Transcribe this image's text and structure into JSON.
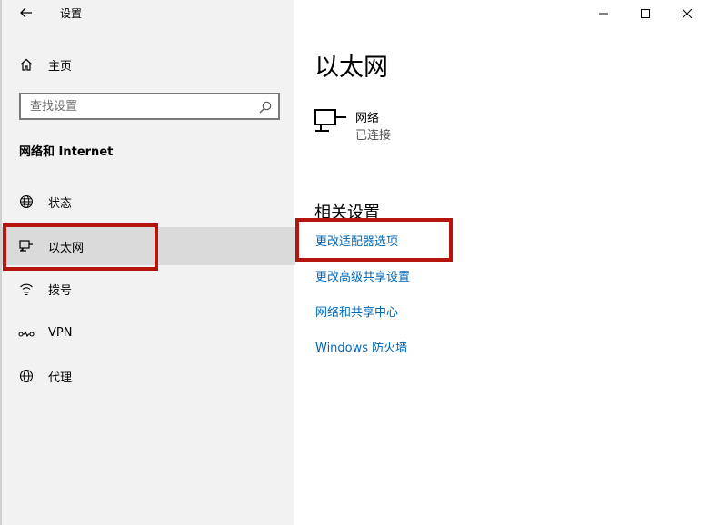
{
  "window": {
    "title": "设置",
    "controls": {
      "minimize": "—",
      "maximize": "☐",
      "close": "✕"
    }
  },
  "sidebar": {
    "home_label": "主页",
    "search": {
      "placeholder": "查找设置",
      "value": ""
    },
    "section_title": "网络和 Internet",
    "items": [
      {
        "label": "状态",
        "icon": "status-globe-icon",
        "selected": false
      },
      {
        "label": "以太网",
        "icon": "ethernet-icon",
        "selected": true
      },
      {
        "label": "拨号",
        "icon": "dialup-icon",
        "selected": false
      },
      {
        "label": "VPN",
        "icon": "vpn-icon",
        "selected": false
      },
      {
        "label": "代理",
        "icon": "proxy-globe-icon",
        "selected": false
      }
    ]
  },
  "main": {
    "title": "以太网",
    "network": {
      "name": "网络",
      "status": "已连接",
      "icon": "network-monitor-icon"
    },
    "related_title": "相关设置",
    "links": [
      "更改适配器选项",
      "更改高级共享设置",
      "网络和共享中心",
      "Windows 防火墙"
    ]
  },
  "colors": {
    "sidebar_bg": "#f2f2f2",
    "selected_bg": "#dadada",
    "link": "#0067b8",
    "highlight_box": "#b6140f"
  }
}
